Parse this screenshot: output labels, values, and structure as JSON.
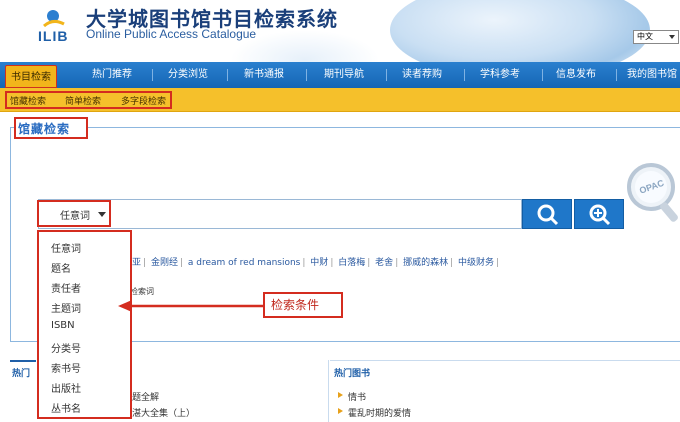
{
  "header": {
    "logo_text": "ILIB",
    "title_cn": "大学城图书馆书目检索系统",
    "title_en": "Online Public Access Catalogue",
    "language": "中文"
  },
  "nav": {
    "items": [
      "书目检索",
      "热门推荐",
      "分类浏览",
      "新书通报",
      "期刊导航",
      "读者荐购",
      "学科参考",
      "信息发布",
      "我的图书馆"
    ]
  },
  "subnav": {
    "items": [
      "馆藏检索",
      "简单检索",
      "多字段检索"
    ]
  },
  "panel": {
    "title": "馆藏检索",
    "opac_label": "OPAC"
  },
  "search": {
    "field_selected": "任意词",
    "options": [
      "任意词",
      "题名",
      "责任者",
      "主题词",
      "ISBN",
      "分类号",
      "索书号",
      "出版社",
      "丛书名"
    ]
  },
  "hotwords": [
    "亚利亚",
    "金刚经",
    "a dream of red mansions",
    "中财",
    "白落梅",
    "老舍",
    "挪威的森林",
    "中级财务"
  ],
  "hint_text": "检索词",
  "annotation": "检索条件",
  "bottom": {
    "left_head": "热门",
    "left_items": [
      "题全解",
      "湛大全集（上）"
    ],
    "right_head": "热门图书",
    "right_items": [
      "情书",
      "霍乱时期的爱情"
    ]
  }
}
